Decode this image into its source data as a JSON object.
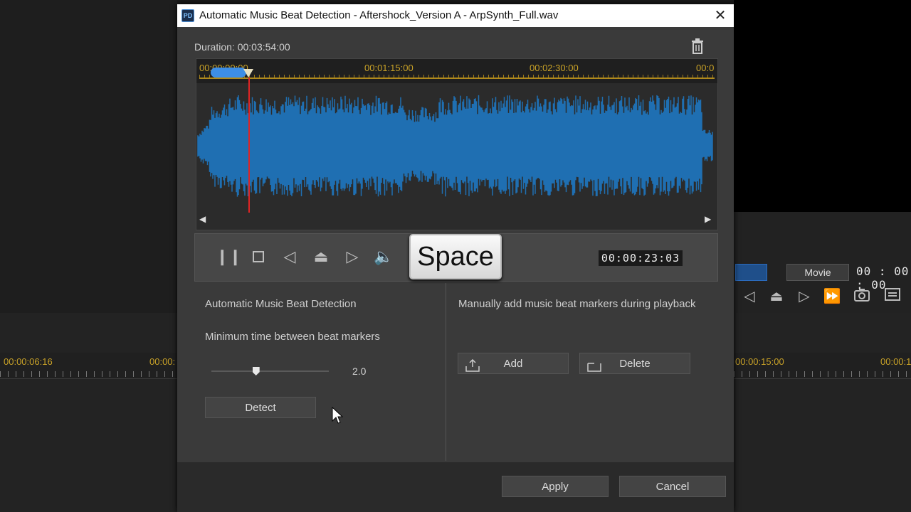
{
  "background": {
    "ruler_times": [
      "00:00:06:16",
      "00:00:",
      "00:00:15:00",
      "00:00:1"
    ],
    "movie_tab": "Movie",
    "timecode": "00 : 00 : 00"
  },
  "dialog": {
    "title": "Automatic Music Beat Detection - Aftershock_Version A - ArpSynth_Full.wav",
    "duration_label": "Duration: 00:03:54:00",
    "timeline_labels": [
      "00:00:00:00",
      "00:01:15:00",
      "00:02:30:00",
      "00:0"
    ],
    "space_key": "Space",
    "timecode": "00:00:23:03",
    "auto_section": {
      "heading": "Automatic Music Beat Detection",
      "min_time_label": "Minimum time between beat markers",
      "slider_value": "2.0",
      "slider_fraction": 0.38,
      "detect_label": "Detect"
    },
    "manual_section": {
      "heading": "Manually add music beat markers during playback",
      "add_label": "Add",
      "delete_label": "Delete"
    },
    "apply_label": "Apply",
    "cancel_label": "Cancel"
  },
  "colors": {
    "waveform": "#1f6fb2",
    "playhead": "#e02424",
    "timeline_text": "#c9a227"
  }
}
